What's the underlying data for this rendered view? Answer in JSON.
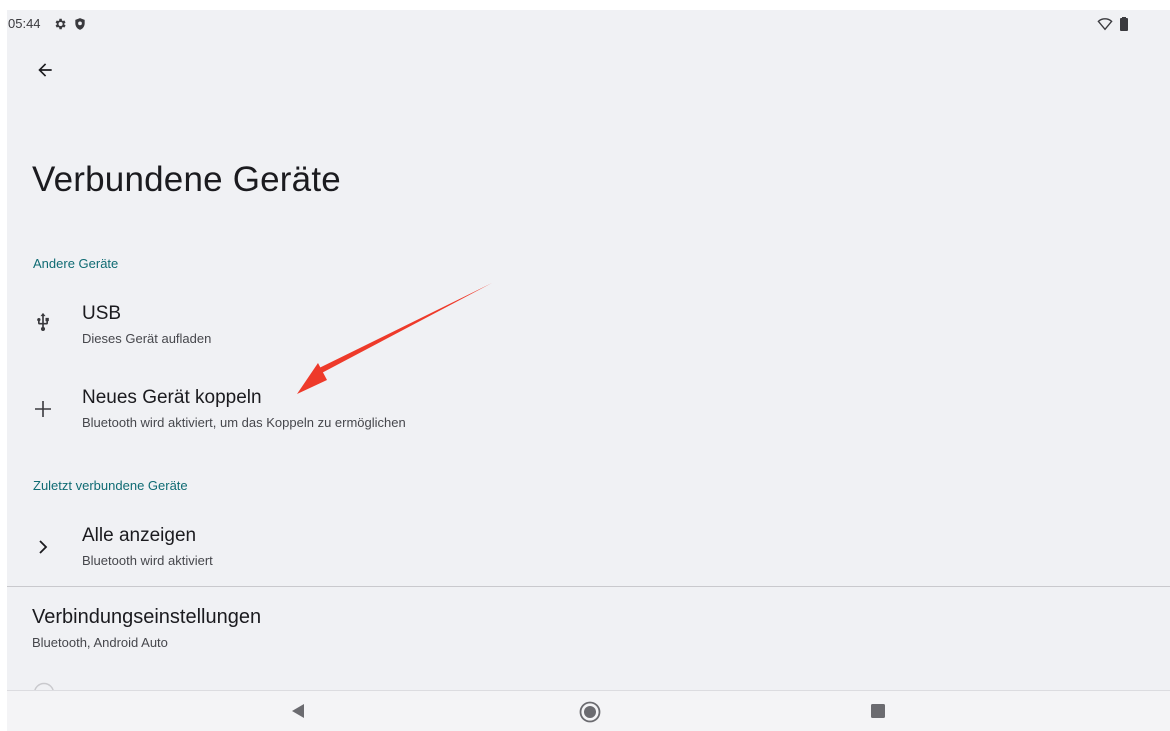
{
  "status_bar": {
    "time": "05:44",
    "icons": [
      "gear-icon",
      "shield-icon",
      "wifi-icon",
      "battery-icon"
    ]
  },
  "header": {
    "back_icon": "arrow-left-icon",
    "title": "Verbundene Geräte"
  },
  "sections": [
    {
      "header": "Andere Geräte",
      "items": [
        {
          "icon": "usb-icon",
          "title": "USB",
          "summary": "Dieses Gerät aufladen"
        },
        {
          "icon": "plus-icon",
          "title": "Neues Gerät koppeln",
          "summary": "Bluetooth wird aktiviert, um das Koppeln zu ermöglichen"
        }
      ]
    },
    {
      "header": "Zuletzt verbundene Geräte",
      "items": [
        {
          "icon": "chevron-right-icon",
          "title": "Alle anzeigen",
          "summary": "Bluetooth wird aktiviert"
        }
      ]
    }
  ],
  "connection_settings": {
    "title": "Verbindungseinstellungen",
    "summary": "Bluetooth, Android Auto"
  },
  "footer_icon": "info-icon",
  "nav_bar": {
    "back": "nav-back-icon",
    "home": "nav-home-icon",
    "recents": "nav-recents-icon"
  },
  "colors": {
    "background": "#f0f1f4",
    "section_header": "#0f6b73",
    "annotation_arrow": "#ee3a2a"
  }
}
